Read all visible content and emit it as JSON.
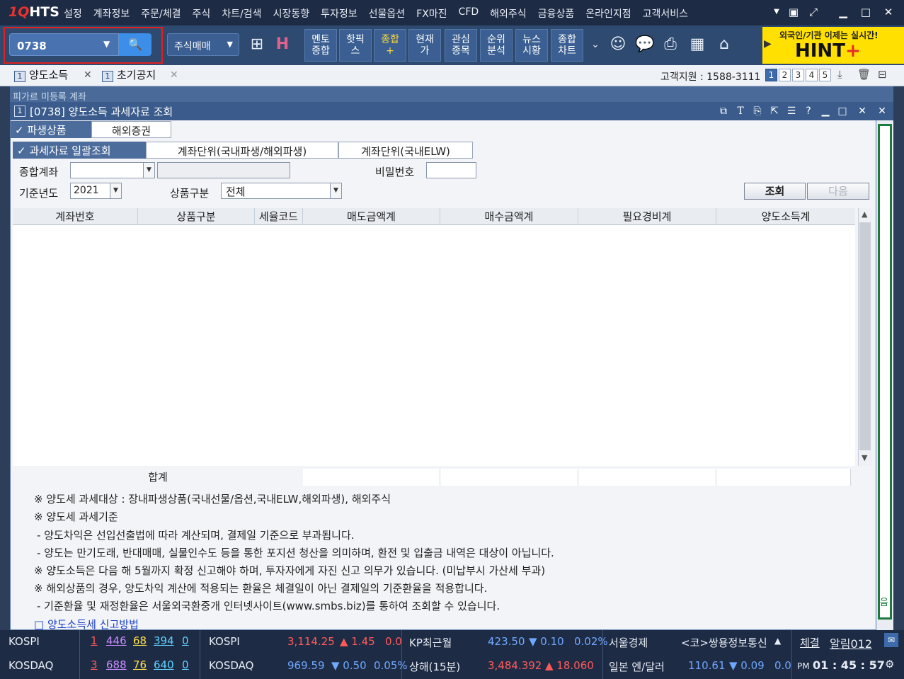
{
  "app": {
    "logo_one": "1Q",
    "logo_rest": "HTS"
  },
  "menu": [
    "설정",
    "계좌정보",
    "주문/체결",
    "주식",
    "차트/검색",
    "시장동향",
    "투자정보",
    "선물옵션",
    "FX마진",
    "CFD",
    "해외주식",
    "금융상품",
    "온라인지점",
    "고객서비스"
  ],
  "toolbar": {
    "code_value": "0738",
    "trade_select": "주식매매",
    "buttons": [
      {
        "label": "멘토\n종합",
        "highlight": false
      },
      {
        "label": "핫픽\n스",
        "highlight": false
      },
      {
        "label": "종합\n+",
        "highlight": true
      },
      {
        "label": "현재\n가",
        "highlight": false
      },
      {
        "label": "관심\n종목",
        "highlight": false
      },
      {
        "label": "순위\n분석",
        "highlight": false
      },
      {
        "label": "뉴스\n시황",
        "highlight": false
      },
      {
        "label": "종합\n차트",
        "highlight": false
      }
    ],
    "hint_line1": "외국인/기관 이제는 실시간!",
    "hint_main": "HINT",
    "hint_plus": "+"
  },
  "tabs": [
    {
      "num": "1",
      "label": "양도소득"
    },
    {
      "num": "1",
      "label": "초기공지"
    }
  ],
  "support": "고객지원 : 1588-3111",
  "pages": [
    "1",
    "2",
    "3",
    "4",
    "5"
  ],
  "bg_window_title": "피가르 미등록 계좌",
  "window": {
    "num": "1",
    "title": "[0738] 양도소득 과세자료 조회"
  },
  "product_tabs": [
    "파생상품",
    "해외증권"
  ],
  "sub_tabs": [
    "과세자료 일괄조회",
    "계좌단위(국내파생/해외파생)",
    "계좌단위(국내ELW)"
  ],
  "form": {
    "account_label": "종합계좌",
    "password_label": "비밀번호",
    "year_label": "기준년도",
    "year_value": "2021",
    "product_label": "상품구분",
    "product_value": "전체",
    "search_button": "조회",
    "next_button": "다음"
  },
  "table": {
    "columns": [
      "계좌번호",
      "상품구분",
      "세율코드",
      "매도금액계",
      "매수금액계",
      "필요경비계",
      "양도소득계"
    ],
    "rows": [],
    "sum_label": "합계"
  },
  "notes": [
    "※ 양도세 과세대상 : 장내파생상품(국내선물/옵션,국내ELW,해외파생), 해외주식",
    "※ 양도세 과세기준",
    " - 양도차익은 선입선출법에 따라 계산되며, 결제일 기준으로 부과됩니다.",
    " - 양도는 만기도래, 반대매매, 실물인수도 등을 통한 포지션 청산을 의미하며, 환전 및 입출금 내역은 대상이 아닙니다.",
    "※ 양도소득은 다음 해 5월까지 확정 신고해야 하며, 투자자에게 자진 신고 의무가 있습니다. (미납부시 가산세 부과)",
    "※ 해외상품의 경우, 양도차익 계산에 적용되는 환율은 체결일이 아닌 결제일의 기준환율을 적용합니다.",
    " - 기준환율 및 재정환율은 서울외국환중개 인터넷사이트(www.smbs.biz)를 통하여 조회할 수 있습니다."
  ],
  "note_link": "□ 양도소득세 신고방법",
  "right_strip_text": "음",
  "status": {
    "row1": {
      "idx1": "KOSPI",
      "idx1_a": "1",
      "idx1_b": "446",
      "idx1_c": "68",
      "idx1_d": "394",
      "idx1_e": "0",
      "idx2": "KOSPI",
      "idx2_val": "3,114.25",
      "idx2_chg": "▲ 1.45",
      "idx2_pct": "0.0",
      "fut": "KP최근월",
      "fut_val": "423.50",
      "fut_chg": "▼ 0.10",
      "fut_pct": "0.02%",
      "news_src": "서울경제",
      "news": "<코>쌍용정보통신",
      "fill": "체결",
      "alarm": "알림012"
    },
    "row2": {
      "idx1": "KOSDAQ",
      "idx1_a": "3",
      "idx1_b": "688",
      "idx1_c": "76",
      "idx1_d": "640",
      "idx1_e": "0",
      "idx2": "KOSDAQ",
      "idx2_val": "969.59",
      "idx2_chg": "▼ 0.50",
      "idx2_pct": "0.05%",
      "fut": "상해(15분)",
      "fut_val": "3,484.392",
      "fut_chg": "▲ 18.060",
      "fx": "일본 엔/달러",
      "fx_val": "110.61",
      "fx_chg": "▼ 0.09",
      "fx_pct": "0.0",
      "ampm": "PM",
      "clock": "01 : 45 : 57"
    }
  },
  "colors": {
    "menubar": "#1e2b45",
    "toolbar": "#2f4a70",
    "accent": "#3d8ee8",
    "hint": "#ffe000"
  }
}
